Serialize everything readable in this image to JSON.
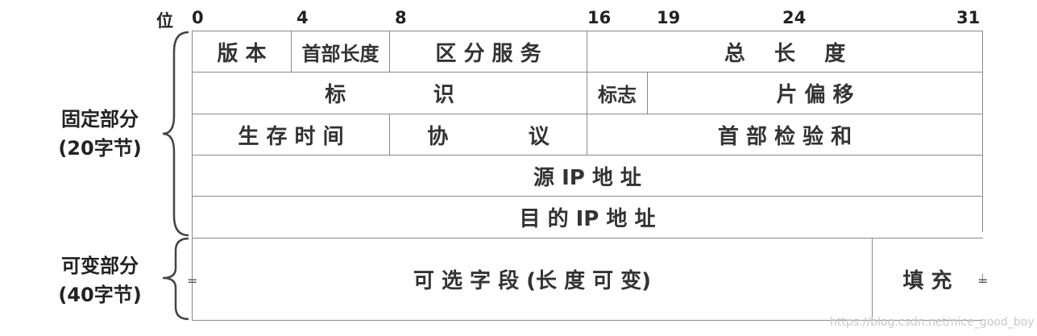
{
  "bit_label": "位",
  "bit_positions": [
    "0",
    "4",
    "8",
    "16",
    "19",
    "24",
    "31"
  ],
  "rows": {
    "r1": {
      "version": "版 本",
      "header_length": "首部长度",
      "diff_services": "区 分 服 务",
      "total_length": "总    长    度"
    },
    "r2": {
      "identification": "标            识",
      "flags": "标志",
      "fragment_offset": "片 偏 移"
    },
    "r3": {
      "ttl": "生 存 时 间",
      "protocol": "协           议",
      "header_checksum": "首 部 检 验 和"
    },
    "r4": {
      "source_ip": "源 IP 地 址"
    },
    "r5": {
      "dest_ip": "目 的 IP 地 址"
    },
    "r6": {
      "options": "可 选 字 段 (长 度 可 变)",
      "padding": "填 充"
    }
  },
  "labels": {
    "fixed_part": "固定部分",
    "fixed_size": "(20字节)",
    "variable_part": "可变部分",
    "variable_size": "(40字节)"
  },
  "markers": {
    "eq_left": "=",
    "eq_right": "="
  },
  "watermark": "https://blog.csdn.net/nice_good_boy"
}
